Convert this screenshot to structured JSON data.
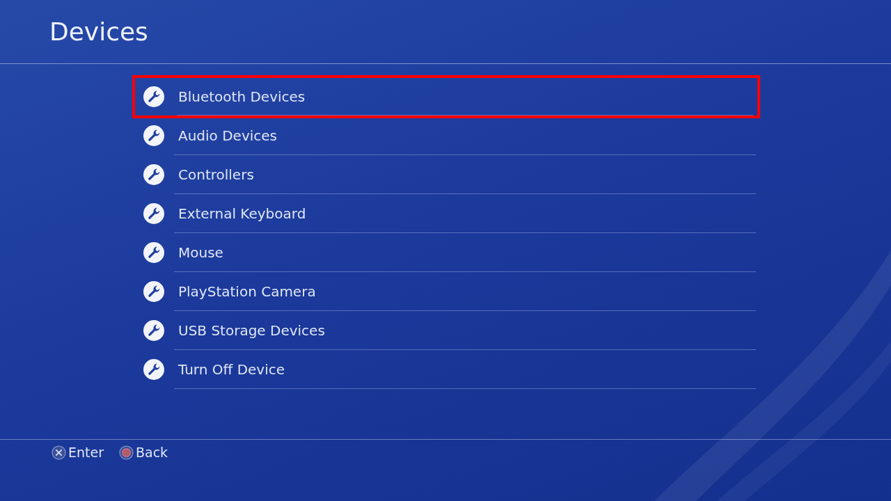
{
  "header": {
    "title": "Devices"
  },
  "menu": {
    "items": [
      {
        "label": "Bluetooth Devices",
        "selected": true
      },
      {
        "label": "Audio Devices",
        "selected": false
      },
      {
        "label": "Controllers",
        "selected": false
      },
      {
        "label": "External Keyboard",
        "selected": false
      },
      {
        "label": "Mouse",
        "selected": false
      },
      {
        "label": "PlayStation Camera",
        "selected": false
      },
      {
        "label": "USB Storage Devices",
        "selected": false
      },
      {
        "label": "Turn Off Device",
        "selected": false
      }
    ]
  },
  "footer": {
    "hints": [
      {
        "kind": "cross",
        "label": "Enter"
      },
      {
        "kind": "circle",
        "label": "Back"
      }
    ]
  }
}
